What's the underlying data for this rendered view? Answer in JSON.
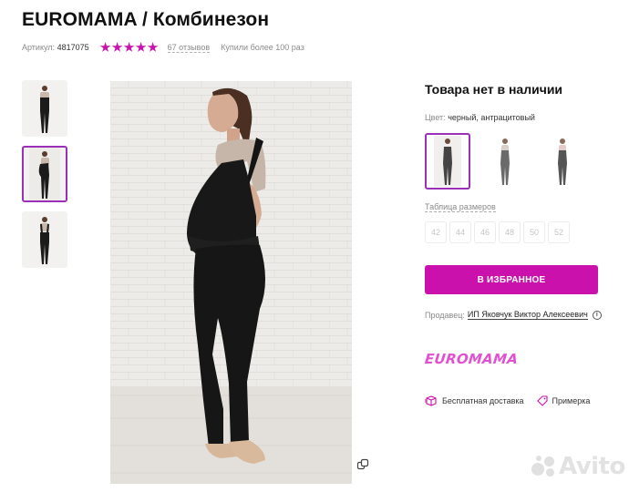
{
  "product": {
    "title": "EUROMAMA / Комбинезон",
    "article_label": "Артикул:",
    "article_value": "4817075",
    "rating": 5,
    "reviews": "67 отзывов",
    "purchases": "Купили более 100 раз"
  },
  "gallery": {
    "thumbnails": [
      "thumb-1",
      "thumb-2",
      "thumb-3"
    ],
    "active_index": 1
  },
  "availability": "Товара нет в наличии",
  "color": {
    "label": "Цвет:",
    "value": "черный, антрацитовый"
  },
  "sizes": {
    "label": "Таблица размеров",
    "options": [
      "42",
      "44",
      "46",
      "48",
      "50",
      "52"
    ]
  },
  "actions": {
    "favorite_label": "В ИЗБРАННОЕ"
  },
  "seller": {
    "label": "Продавец:",
    "name": "ИП Яковчук Виктор Алексеевич"
  },
  "brand_logo": "EUROMAMA",
  "features": [
    {
      "icon": "delivery-box-icon",
      "label": "Бесплатная доставка"
    },
    {
      "icon": "tag-icon",
      "label": "Примерка"
    }
  ],
  "watermark": "Avito",
  "colors": {
    "accent": "#cb11ab",
    "active_border": "#9b2fb8",
    "logo": "#e24fd0"
  }
}
